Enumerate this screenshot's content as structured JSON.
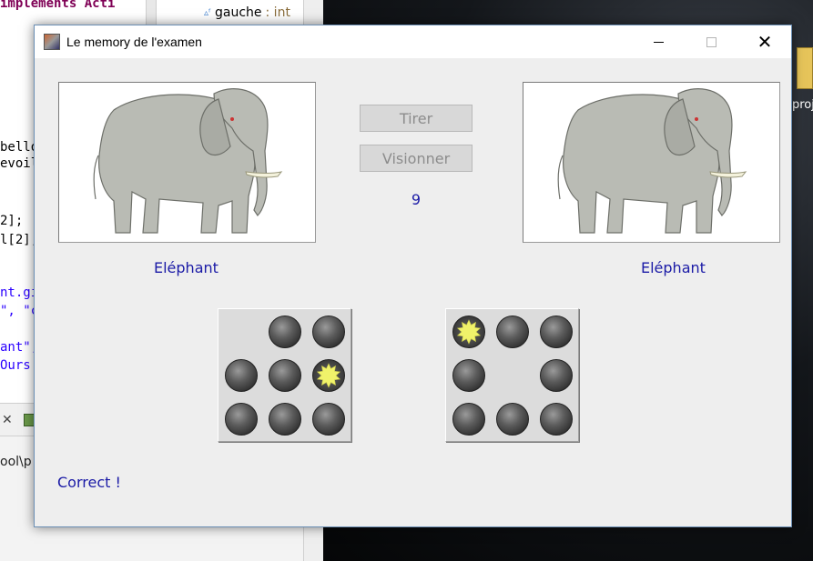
{
  "ide": {
    "code_lines": [
      "implements Acti",
      "bello",
      "evoil",
      "2];",
      "l[2];",
      "nt.gi",
      "\", \"c",
      "ant\",",
      "Ours"
    ],
    "outline_item": "gauche",
    "outline_type": ": int",
    "console_path": "ool\\p"
  },
  "desktop": {
    "folder_label": "proj"
  },
  "window": {
    "title": "Le memory de l'examen",
    "controls": {
      "minimize": "minimize",
      "maximize": "maximize",
      "close": "close"
    }
  },
  "game": {
    "left_card_label": "Eléphant",
    "right_card_label": "Eléphant",
    "draw_button": "Tirer",
    "view_button": "Visionner",
    "counter": "9",
    "status": "Correct !",
    "left_grid": [
      "empty",
      "ball",
      "ball",
      "ball",
      "ball",
      "star",
      "ball",
      "ball",
      "ball"
    ],
    "right_grid": [
      "star",
      "ball",
      "ball",
      "ball",
      "empty",
      "ball",
      "ball",
      "ball",
      "ball"
    ],
    "accent_color": "#1a1aa6",
    "star_color": "#f0f26a"
  }
}
